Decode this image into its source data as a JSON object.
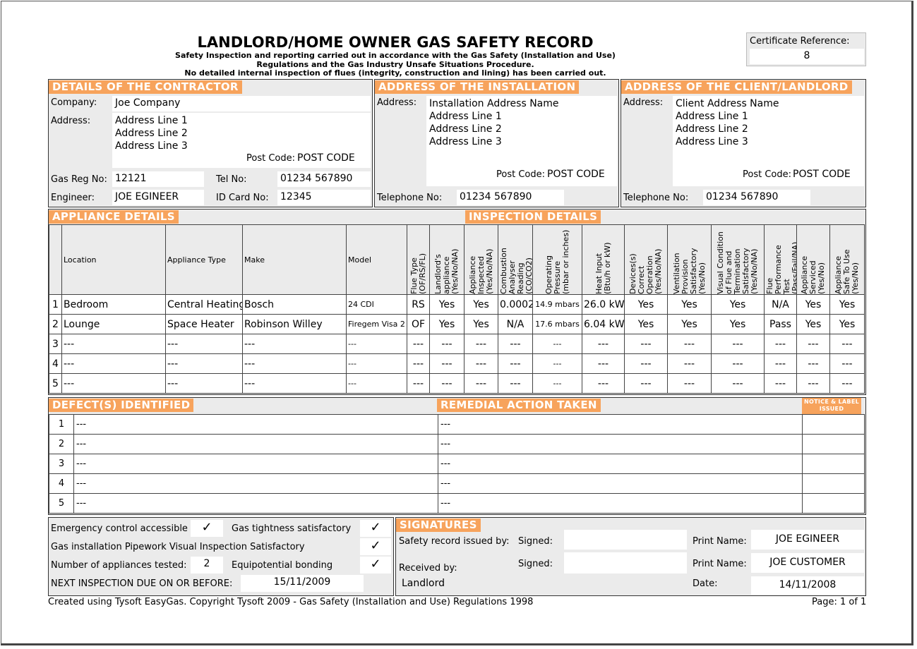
{
  "header": {
    "title": "LANDLORD/HOME OWNER GAS SAFETY RECORD",
    "sub1": "Safety Inspection and reporting carried out in accordance with the Gas Safety (Installation and Use)",
    "sub2": "Regulations and the Gas Industry Unsafe Situations Procedure.",
    "sub3": "No detailed internal inspection of flues (integrity, construction and lining) has been carried out.",
    "cert_label": "Certificate Reference:",
    "cert_value": "8"
  },
  "contractor": {
    "heading": "DETAILS OF THE CONTRACTOR",
    "company_label": "Company:",
    "company": "Joe Company",
    "address_label": "Address:",
    "address": [
      "Address Line 1",
      "Address Line 2",
      "Address Line 3"
    ],
    "postcode_label": "Post Code:",
    "postcode": "POST CODE",
    "gasreg_label": "Gas Reg No:",
    "gasreg": "12121",
    "tel_label": "Tel No:",
    "tel": "01234 567890",
    "engineer_label": "Engineer:",
    "engineer": "JOE EGINEER",
    "idcard_label": "ID Card No:",
    "idcard": "12345"
  },
  "installation": {
    "heading": "ADDRESS OF THE INSTALLATION",
    "address_label": "Address:",
    "address": [
      "Installation Address Name",
      "Address Line 1",
      "Address Line 2",
      "Address Line 3"
    ],
    "postcode_label": "Post Code:",
    "postcode": "POST CODE",
    "tel_label": "Telephone No:",
    "tel": "01234 567890"
  },
  "client": {
    "heading": "ADDRESS OF THE CLIENT/LANDLORD",
    "address_label": "Address:",
    "address": [
      "Client Address Name",
      "Address Line 1",
      "Address Line 2",
      "Address Line 3"
    ],
    "postcode_label": "Post Code:",
    "postcode": "POST CODE",
    "tel_label": "Telephone No:",
    "tel": "01234 567890"
  },
  "appliances": {
    "heading": "APPLIANCE DETAILS",
    "inspection_heading": "INSPECTION DETAILS",
    "columns": [
      "Location",
      "Appliance Type",
      "Make",
      "Model",
      "Flue Type\n(OF/RS/FL)",
      "Landlord's\nappliance\n(Yes/No/NA)",
      "Appliance\nInspected\n(Yes/No/NA)",
      "Combustion\nAnalyser Reading\n(CO/CO2)",
      "Operating\nPressure\n(mbar or inches)",
      "Heat Input\n(Btu/h or kW)",
      "Devices(s)\nCorrect\nOperation\n(Yes/No/NA)",
      "Ventilation\nProvision\nSatisfactory\n(Yes/No)",
      "Visual Condition\nof Flue and\nTermination\nSatisfactory\n(Yes/No/NA)",
      "Flue Performance\nTest\n(Pass/Fail/NA)",
      "Appliance\nServiced\n(Yes/No)",
      "Appliance\nSafe To Use\n(Yes/No)"
    ],
    "rows": [
      [
        "1",
        "Bedroom",
        "Central Heating",
        "Bosch",
        "24 CDI",
        "RS",
        "Yes",
        "Yes",
        "0.0002",
        "14.9 mbars",
        "26.0 kW",
        "Yes",
        "Yes",
        "Yes",
        "N/A",
        "Yes",
        "Yes"
      ],
      [
        "2",
        "Lounge",
        "Space Heater",
        "Robinson Willey",
        "Firegem Visa 2",
        "OF",
        "Yes",
        "Yes",
        "N/A",
        "17.6 mbars",
        "6.04 kW",
        "Yes",
        "Yes",
        "Yes",
        "Pass",
        "Yes",
        "Yes"
      ],
      [
        "3",
        "---",
        "---",
        "---",
        "---",
        "---",
        "---",
        "---",
        "---",
        "---",
        "---",
        "---",
        "---",
        "---",
        "---",
        "---",
        "---"
      ],
      [
        "4",
        "---",
        "---",
        "---",
        "---",
        "---",
        "---",
        "---",
        "---",
        "---",
        "---",
        "---",
        "---",
        "---",
        "---",
        "---",
        "---"
      ],
      [
        "5",
        "---",
        "---",
        "---",
        "---",
        "---",
        "---",
        "---",
        "---",
        "---",
        "---",
        "---",
        "---",
        "---",
        "---",
        "---",
        "---"
      ]
    ]
  },
  "defects": {
    "heading": "DEFECT(S) IDENTIFIED",
    "remedial_heading": "REMEDIAL ACTION TAKEN",
    "notice_heading": "NOTICE & LABEL ISSUED",
    "rows": [
      [
        "1",
        "---",
        "---",
        ""
      ],
      [
        "2",
        "---",
        "---",
        ""
      ],
      [
        "3",
        "---",
        "---",
        ""
      ],
      [
        "4",
        "---",
        "---",
        ""
      ],
      [
        "5",
        "---",
        "---",
        ""
      ]
    ]
  },
  "checks": {
    "emergency_label": "Emergency control accessible",
    "emergency": "✓",
    "gas_tight_label": "Gas tightness satisfactory",
    "gas_tight": "✓",
    "pipework_label": "Gas installation Pipework Visual Inspection Satisfactory",
    "pipework": "✓",
    "num_label": "Number of appliances tested:",
    "num": "2",
    "equi_label": "Equipotential bonding",
    "equi": "✓",
    "next_label": "NEXT INSPECTION DUE ON OR BEFORE:",
    "next": "15/11/2009"
  },
  "signatures": {
    "heading": "SIGNATURES",
    "issued_label": "Safety record issued by:",
    "signed_label": "Signed:",
    "print_label": "Print Name:",
    "issued_name": "JOE EGINEER",
    "received_label": "Received by:",
    "received_name": "JOE CUSTOMER",
    "received_role": "Landlord",
    "date_label": "Date:",
    "date": "14/11/2008"
  },
  "footer": {
    "left": "Created using Tysoft EasyGas. Copyright Tysoft 2009 - Gas Safety (Installation and Use) Regulations 1998",
    "right": "Page: 1 of 1"
  }
}
